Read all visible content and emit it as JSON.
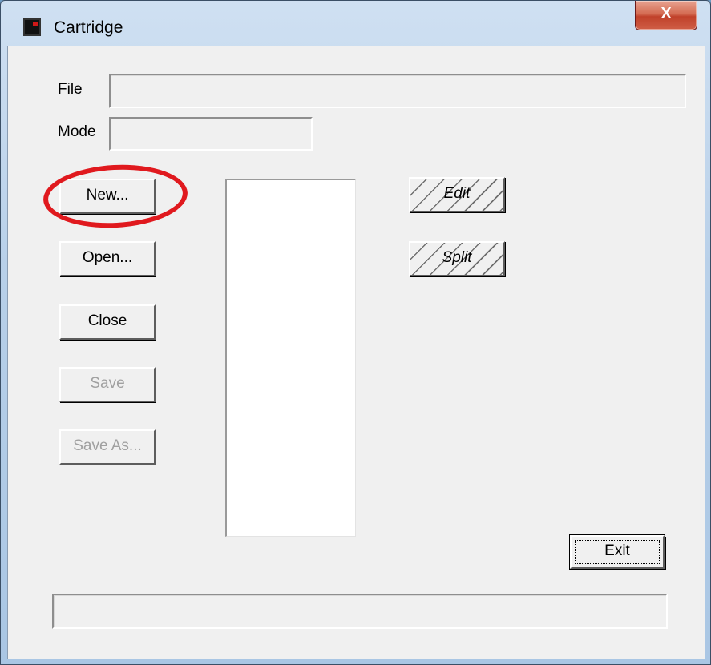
{
  "window": {
    "title": "Cartridge",
    "close_glyph": "X"
  },
  "labels": {
    "file": "File",
    "mode": "Mode"
  },
  "fields": {
    "file_value": "",
    "mode_value": "",
    "status_value": ""
  },
  "buttons": {
    "new": "New...",
    "open": "Open...",
    "close": "Close",
    "save": "Save",
    "save_as": "Save As...",
    "edit": "Edit",
    "split": "Split",
    "exit": "Exit"
  },
  "list": {
    "items": []
  },
  "colors": {
    "annotation": "#e0191e",
    "dialog_bg": "#f0f0f0",
    "close_button": "#c0412a"
  },
  "icons": {
    "app": "cartridge-app-icon",
    "close": "close-x-icon"
  }
}
